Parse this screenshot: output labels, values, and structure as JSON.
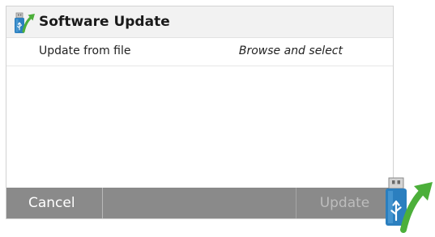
{
  "dialog": {
    "title": "Software Update",
    "title_icon": "usb-update-icon"
  },
  "file_row": {
    "label": "Update from file",
    "value": "Browse and select"
  },
  "buttons": {
    "cancel_label": "Cancel",
    "update_label": "Update",
    "update_enabled": false
  },
  "decorative_icon": "usb-update-icon",
  "colors": {
    "title_bar_bg": "#f2f2f2",
    "button_bar_bg": "#8a8a8a",
    "icon_blue": "#2b7fbf",
    "icon_green": "#4caf3a"
  }
}
